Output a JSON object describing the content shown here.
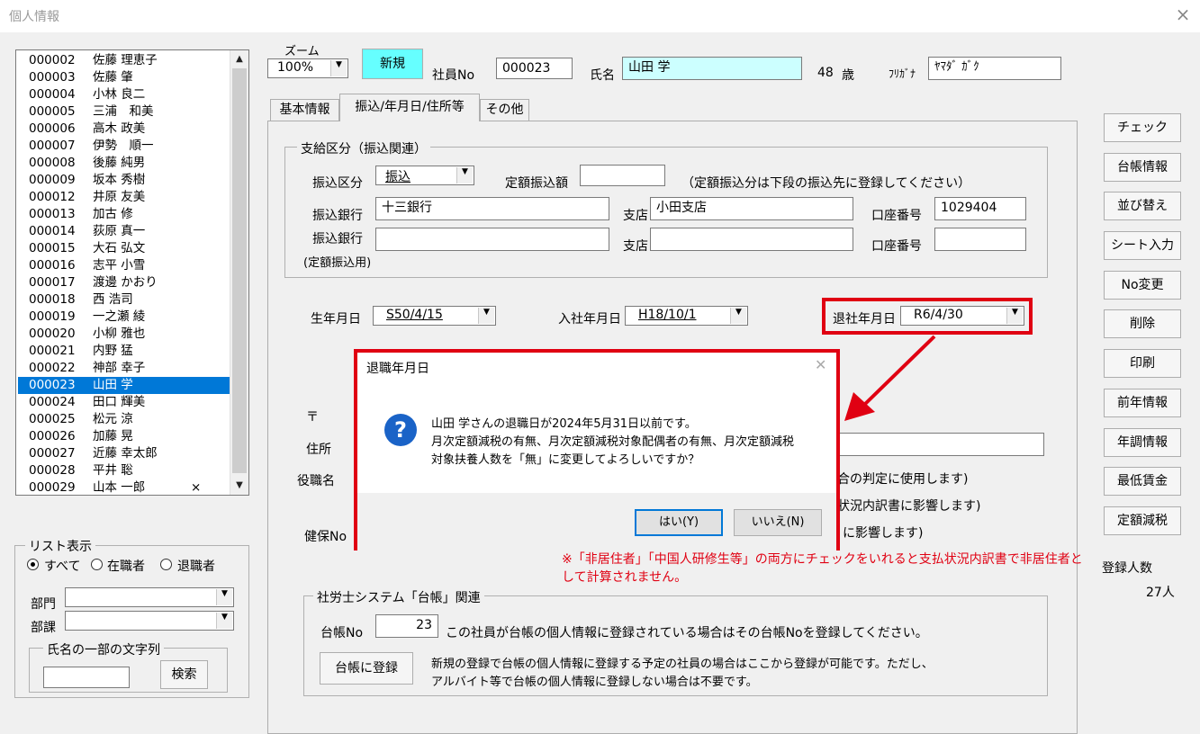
{
  "window": {
    "title": "個人情報",
    "close": "×"
  },
  "employees": [
    {
      "no": "000002",
      "name": "佐藤 理恵子",
      "mark": ""
    },
    {
      "no": "000003",
      "name": "佐藤 肇",
      "mark": ""
    },
    {
      "no": "000004",
      "name": "小林 良二",
      "mark": ""
    },
    {
      "no": "000005",
      "name": "三浦　和美",
      "mark": ""
    },
    {
      "no": "000006",
      "name": "高木 政美",
      "mark": ""
    },
    {
      "no": "000007",
      "name": "伊勢　順一",
      "mark": ""
    },
    {
      "no": "000008",
      "name": "後藤 純男",
      "mark": ""
    },
    {
      "no": "000009",
      "name": "坂本 秀樹",
      "mark": ""
    },
    {
      "no": "000012",
      "name": "井原 友美",
      "mark": ""
    },
    {
      "no": "000013",
      "name": "加古 修",
      "mark": ""
    },
    {
      "no": "000014",
      "name": "荻原 真一",
      "mark": ""
    },
    {
      "no": "000015",
      "name": "大石 弘文",
      "mark": ""
    },
    {
      "no": "000016",
      "name": "志平 小雪",
      "mark": ""
    },
    {
      "no": "000017",
      "name": "渡邊 かおり",
      "mark": ""
    },
    {
      "no": "000018",
      "name": "西 浩司",
      "mark": ""
    },
    {
      "no": "000019",
      "name": "一之瀬 綾",
      "mark": ""
    },
    {
      "no": "000020",
      "name": "小柳 雅也",
      "mark": ""
    },
    {
      "no": "000021",
      "name": "内野 猛",
      "mark": ""
    },
    {
      "no": "000022",
      "name": "神部 幸子",
      "mark": ""
    },
    {
      "no": "000023",
      "name": "山田 学",
      "mark": ""
    },
    {
      "no": "000024",
      "name": "田口 輝美",
      "mark": ""
    },
    {
      "no": "000025",
      "name": "松元 涼",
      "mark": ""
    },
    {
      "no": "000026",
      "name": "加藤 晃",
      "mark": ""
    },
    {
      "no": "000027",
      "name": "近藤 幸太郎",
      "mark": ""
    },
    {
      "no": "000028",
      "name": "平井 聡",
      "mark": ""
    },
    {
      "no": "000029",
      "name": "山本 一郎",
      "mark": "×"
    }
  ],
  "selected_index": 19,
  "list_filter": {
    "legend": "リスト表示",
    "opt_all": "すべて",
    "opt_active": "在職者",
    "opt_retired": "退職者",
    "dept_label": "部門",
    "section_label": "部課",
    "name_group": "氏名の一部の文字列",
    "search_button": "検索"
  },
  "header": {
    "zoom_label": "ズーム",
    "zoom_value": "100%",
    "new_button": "新規",
    "emp_no_label": "社員No",
    "emp_no": "000023",
    "name_label": "氏名",
    "name": "山田 学",
    "age": "48",
    "age_unit": "歳",
    "kana_label": "ﾌﾘｶﾞﾅ",
    "kana": "ﾔﾏﾀﾞ ｶﾞｸ"
  },
  "tabs": [
    "基本情報",
    "振込/年月日/住所等",
    "その他"
  ],
  "payment": {
    "legend": "支給区分（振込関連）",
    "transfer_type_label": "振込区分",
    "transfer_type": "振込",
    "fixed_amount_label": "定額振込額",
    "fixed_note": "（定額振込分は下段の振込先に登録してください）",
    "bank_label": "振込銀行",
    "bank": "十三銀行",
    "branch_label": "支店",
    "branch": "小田支店",
    "account_label": "口座番号",
    "account": "1029404",
    "bank2_label": "振込銀行",
    "bank2_sub": "(定額振込用)",
    "branch2_label": "支店",
    "account2_label": "口座番号"
  },
  "dates": {
    "birth_label": "生年月日",
    "birth": "S50/4/15",
    "join_label": "入社年月日",
    "join": "H18/10/1",
    "retire_label": "退社年月日",
    "retire": "R6/4/30"
  },
  "address": {
    "postal_mark": "〒",
    "address_label": "住所",
    "position_label": "役職名",
    "position_note": "合の判定に使用します)",
    "note2": "状況内訳書に影響します)",
    "health_label": "健保No",
    "note3": "に影響します)",
    "red_note_1": "※「非居住者」「中国人研修生等」の両方にチェックをいれると支払状況内訳書で非居住者と",
    "red_note_2": "して計算されません。"
  },
  "daicho": {
    "legend": "社労士システム「台帳」関連",
    "no_label": "台帳No",
    "no_value": "23",
    "no_desc": "この社員が台帳の個人情報に登録されている場合はその台帳Noを登録してください。",
    "register_button": "台帳に登録",
    "reg_desc_1": "新規の登録で台帳の個人情報に登録する予定の社員の場合はここから登録が可能です。ただし、",
    "reg_desc_2": "アルバイト等で台帳の個人情報に登録しない場合は不要です。"
  },
  "side_buttons": [
    "チェック",
    "台帳情報",
    "並び替え",
    "シート入力",
    "No変更",
    "削除",
    "印刷",
    "前年情報",
    "年調情報",
    "最低賃金",
    "定額減税"
  ],
  "registered": {
    "label": "登録人数",
    "value": "27人"
  },
  "dialog": {
    "title": "退職年月日",
    "line1": "山田 学さんの退職日が2024年5月31日以前です。",
    "line2": "月次定額減税の有無、月次定額減税対象配偶者の有無、月次定額減税",
    "line3": "対象扶養人数を「無」に変更してよろしいですか？",
    "yes": "はい(Y)",
    "no": "いいえ(N)"
  },
  "colors": {
    "accent": "#0078d7",
    "highlight_red": "#e00012",
    "name_field": "#ccffff",
    "new_button": "#66ffff"
  }
}
